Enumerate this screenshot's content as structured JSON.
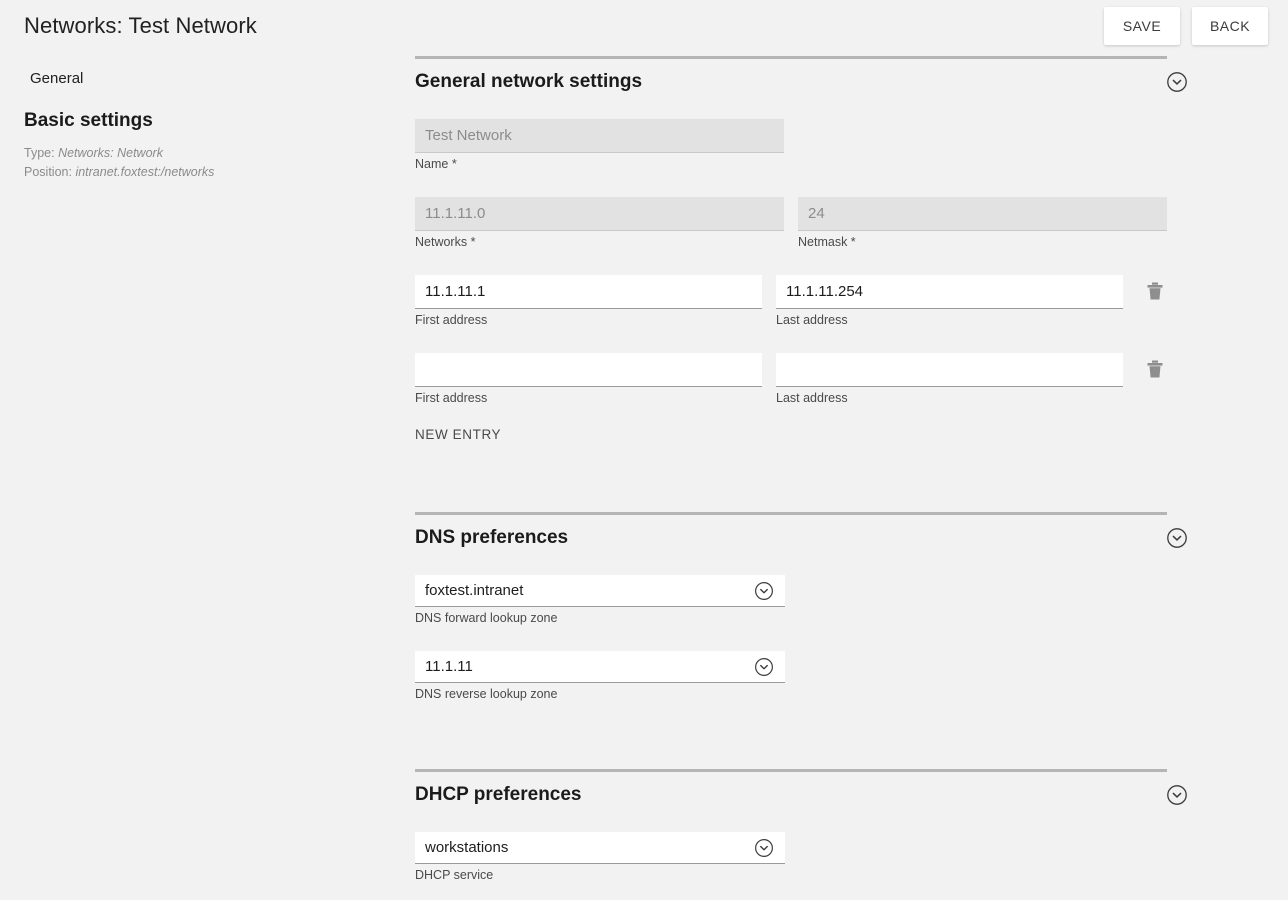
{
  "header": {
    "title": "Networks: Test Network",
    "buttons": [
      {
        "label": "SAVE",
        "name": "save-button"
      },
      {
        "label": "BACK",
        "name": "back-button"
      }
    ]
  },
  "sidebar": {
    "tab": "General",
    "heading": "Basic settings",
    "meta": [
      {
        "key": "Type:",
        "value": "Networks: Network"
      },
      {
        "key": "Position:",
        "value": "intranet.foxtest:/networks"
      }
    ]
  },
  "sections": {
    "general": {
      "title": "General network settings",
      "name_field": {
        "value": "Test Network",
        "label": "Name *",
        "disabled": true
      },
      "networks_field": {
        "value": "11.1.11.0",
        "label": "Networks *",
        "disabled": true
      },
      "netmask_field": {
        "value": "24",
        "label": "Netmask *",
        "disabled": true
      },
      "ranges": [
        {
          "first": {
            "value": "11.1.11.1",
            "label": "First address"
          },
          "last": {
            "value": "11.1.11.254",
            "label": "Last address"
          }
        },
        {
          "first": {
            "value": "",
            "label": "First address"
          },
          "last": {
            "value": "",
            "label": "Last address"
          }
        }
      ],
      "new_entry_label": "NEW ENTRY"
    },
    "dns": {
      "title": "DNS preferences",
      "forward": {
        "value": "foxtest.intranet",
        "label": "DNS forward lookup zone"
      },
      "reverse": {
        "value": "11.1.11",
        "label": "DNS reverse lookup zone"
      }
    },
    "dhcp": {
      "title": "DHCP preferences",
      "service": {
        "value": "workstations",
        "label": "DHCP service"
      }
    }
  },
  "icons": {
    "collapse": "chevron-down-circle-icon",
    "delete": "trash-icon",
    "dropdown": "chevron-down-circle-icon"
  },
  "colors": {
    "page_background": "#f2f2f2",
    "rule": "#b5b5b5",
    "disabled_field": "#e2e2e2",
    "text": "#212121",
    "muted_text": "#8b8b8b"
  }
}
